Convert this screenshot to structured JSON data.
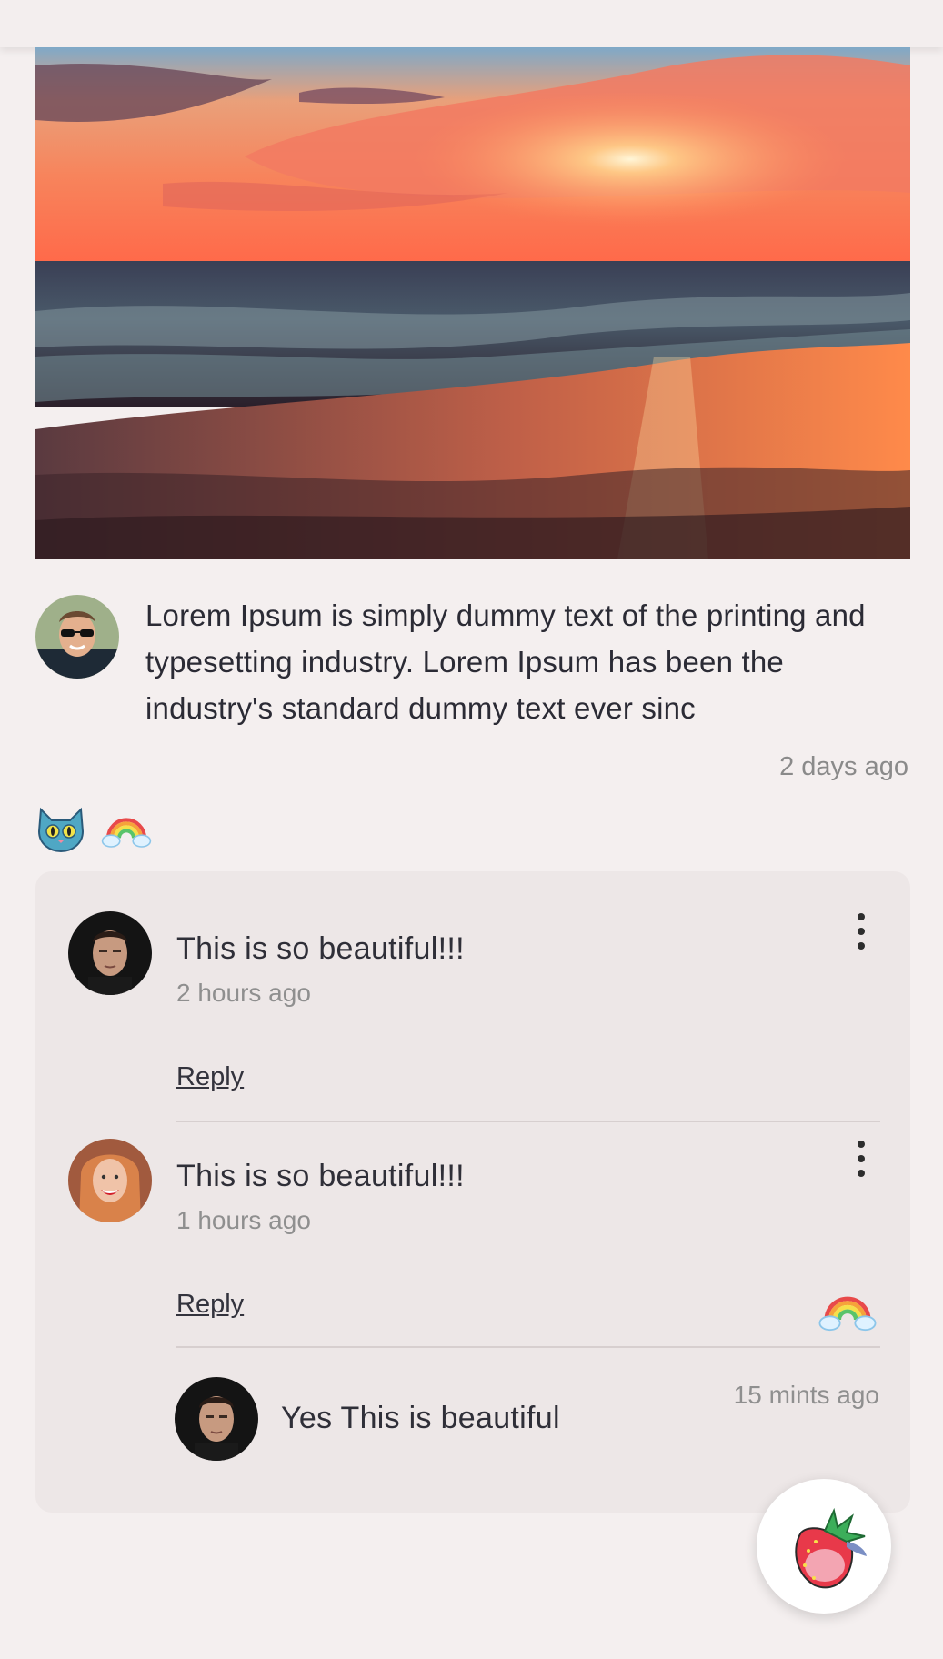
{
  "post": {
    "image_alt": "sunset over ocean beach",
    "text": "Lorem Ipsum is simply dummy text of the printing and typesetting industry. Lorem Ipsum has been the industry's standard dummy text ever sinc",
    "time": "2 days ago",
    "reactions": [
      "cat-face-icon",
      "rainbow-icon"
    ]
  },
  "comments": [
    {
      "text": "This is so beautiful!!!",
      "time": "2 hours ago",
      "reply_label": "Reply",
      "avatar": "man-portrait"
    },
    {
      "text": "This is so beautiful!!!",
      "time": "1 hours ago",
      "reply_label": "Reply",
      "avatar": "woman-portrait",
      "reaction": "rainbow-icon",
      "replies": [
        {
          "text": "Yes This is beautiful",
          "time": "15 mints ago",
          "avatar": "man-portrait"
        }
      ]
    }
  ],
  "fab": {
    "icon": "strawberry-icon"
  },
  "colors": {
    "background": "#f4efef",
    "card": "#ede7e7",
    "text": "#2b2b35",
    "muted": "#8a8a8a"
  }
}
